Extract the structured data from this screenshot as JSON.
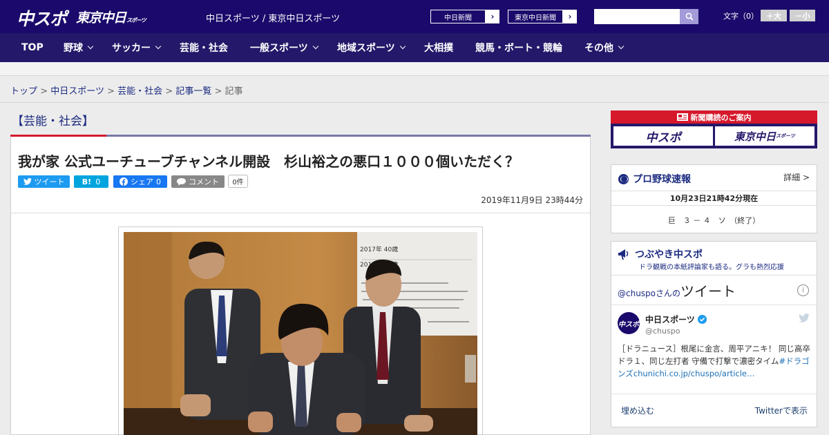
{
  "header": {
    "logo_chuspo": "中スポ",
    "logo_tokyo": "東京中日",
    "logo_tokyo_sub": "スポーツ",
    "site_name": "中日スポーツ / 東京中日スポーツ",
    "ext_links": [
      "中日新聞",
      "東京中日新聞"
    ],
    "search_placeholder": "",
    "font_size_label": "文字（0）",
    "font_larger": "＋大",
    "font_smaller": "－小"
  },
  "nav": {
    "items": [
      {
        "label": "TOP",
        "has_dropdown": false
      },
      {
        "label": "野球",
        "has_dropdown": true
      },
      {
        "label": "サッカー",
        "has_dropdown": true
      },
      {
        "label": "芸能・社会",
        "has_dropdown": false
      },
      {
        "label": "一般スポーツ",
        "has_dropdown": true
      },
      {
        "label": "地域スポーツ",
        "has_dropdown": true
      },
      {
        "label": "大相撲",
        "has_dropdown": false
      },
      {
        "label": "競馬・ボート・競輪",
        "has_dropdown": false
      },
      {
        "label": "その他",
        "has_dropdown": true
      }
    ]
  },
  "breadcrumb": {
    "items": [
      "トップ",
      "中日スポーツ",
      "芸能・社会",
      "記事一覧"
    ],
    "current": "記事",
    "separator": ">"
  },
  "article": {
    "section": "【芸能・社会】",
    "headline": "我が家 公式ユーチューブチャンネル開設　杉山裕之の悪口１０００個いただく？",
    "share": {
      "tweet": "ツイート",
      "hatena": "B!",
      "hatena_count": "0",
      "facebook": "シェア",
      "facebook_count": "0",
      "comment": "コメント",
      "comment_count": "0件"
    },
    "date": "2019年11月9日 23時44分",
    "photo_whiteboard_lines": [
      "2017年 40歳",
      "2018年 41歳"
    ]
  },
  "sidebar": {
    "promo": {
      "title": "新聞購読のご案内",
      "logo1": "中スポ",
      "logo2": "東京中日",
      "logo2_sub": "スポーツ"
    },
    "baseball": {
      "title": "プロ野球速報",
      "detail": "詳細 >",
      "time": "10月23日21時42分現在",
      "score": "巨　３ － ４　ソ　（終了）"
    },
    "tsubuyaki": {
      "title": "つぶやき中スポ",
      "subtitle": "ドラ観戦の本紙評論家も語る。グラも熱烈応援",
      "tweets_prefix": "@chuspoさんの",
      "tweets_word": "ツイート",
      "account_name": "中日スポーツ",
      "account_handle": "@chuspo",
      "tweet_text": "［ドラニュース］根尾に金言、周平アニキ！ 同じ高卒ドラ１、同じ左打者 守備で打撃で濃密タイム",
      "tweet_hashtag": "#ドラゴンズ",
      "tweet_link": "chunichi.co.jp/chuspo/article…",
      "embed": "埋め込む",
      "view_on_twitter": "Twitterで表示"
    }
  },
  "colors": {
    "header_bg": "#1b0a6b",
    "nav_bg": "#24186a",
    "accent_red": "#d6182b",
    "link": "#1b2a80"
  }
}
